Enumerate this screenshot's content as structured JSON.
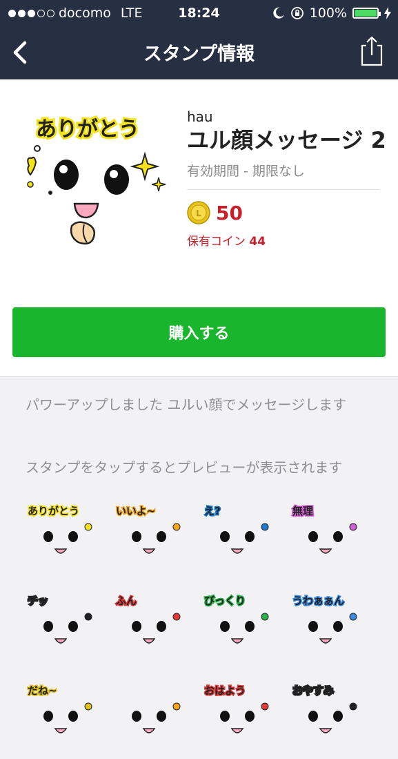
{
  "status_bar": {
    "carrier": "docomo",
    "network": "LTE",
    "time": "18:24",
    "battery": "100%",
    "signal_bars": 3,
    "battery_level": 1.0
  },
  "nav": {
    "title": "スタンプ情報"
  },
  "sticker": {
    "main_text": "ありがとう",
    "author": "hau",
    "title": "ユル顔メッセージ 2",
    "validity": "有効期間 - 期限なし",
    "price": "50",
    "owned_label": "保有コイン",
    "owned_count": "44"
  },
  "buy_button": {
    "label": "購入する"
  },
  "description": "パワーアップしました ユルい顔でメッセージします",
  "preview_hint": "スタンプをタップするとプレビューが表示されます",
  "stickers": [
    {
      "text": "ありがとう",
      "color": "#f4e21a"
    },
    {
      "text": "いいよ~",
      "color": "#f4a51a"
    },
    {
      "text": "え?",
      "color": "#1a7ad0"
    },
    {
      "text": "無理",
      "color": "#d060d0"
    },
    {
      "text": "チッ",
      "color": "#222222"
    },
    {
      "text": "ふん",
      "color": "#e03a3a"
    },
    {
      "text": "びっくり",
      "color": "#2ab04a"
    },
    {
      "text": "うわぁぁん",
      "color": "#3a8ae0"
    },
    {
      "text": "だね~",
      "color": "#e0c020"
    },
    {
      "text": "",
      "color": "#f4a51a"
    },
    {
      "text": "おはよう",
      "color": "#e03a3a"
    },
    {
      "text": "おやすみ",
      "color": "#222222"
    }
  ],
  "colors": {
    "header_bg": "#273042",
    "accent_green": "#19b52d",
    "price_red": "#c8202a",
    "battery_green": "#4cd964"
  }
}
